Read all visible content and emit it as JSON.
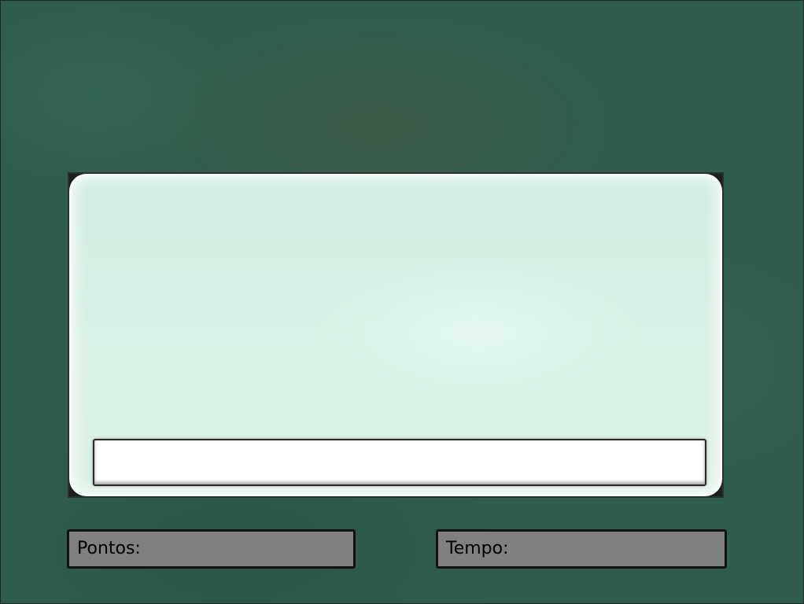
{
  "game": {
    "question_text": "",
    "answer_input": {
      "value": "",
      "placeholder": ""
    },
    "stats": {
      "points_label": "Pontos:",
      "points_value": "",
      "time_label": "Tempo:",
      "time_value": ""
    }
  },
  "colors": {
    "background": "#2f5d4c",
    "panel": "#d9f1e6",
    "input": "#ffffff",
    "stat_box": "#808080"
  }
}
